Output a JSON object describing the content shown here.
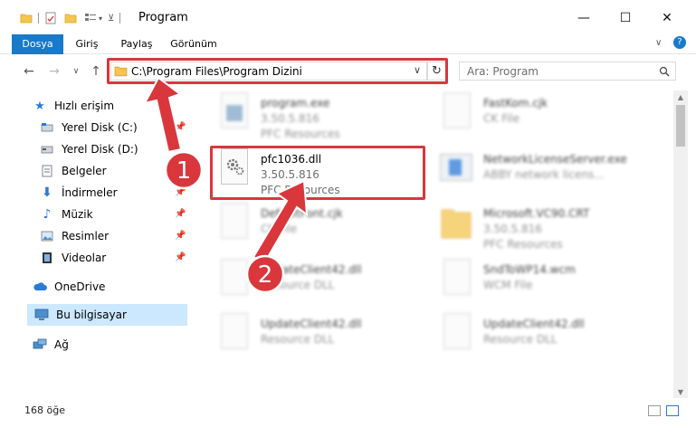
{
  "window": {
    "title": "Program",
    "minimize": "—",
    "maximize": "☐",
    "close": "✕"
  },
  "ribbon": {
    "tabs": [
      "Dosya",
      "Giriş",
      "Paylaş",
      "Görünüm"
    ],
    "help": "?"
  },
  "navigation": {
    "back": "←",
    "forward": "→",
    "recent": "∨",
    "up": "↑",
    "address": "C:\\Program Files\\Program Dizini",
    "address_dropdown": "∨",
    "refresh": "↻",
    "search_placeholder": "Ara: Program"
  },
  "sidebar": {
    "quick_access": "Hızlı erişim",
    "items": [
      {
        "label": "Yerel Disk (C:)",
        "icon": "drive-icon",
        "pinned": true
      },
      {
        "label": "Yerel Disk (D:)",
        "icon": "drive-icon",
        "pinned": false
      },
      {
        "label": "Belgeler",
        "icon": "documents-icon",
        "pinned": true
      },
      {
        "label": "İndirmeler",
        "icon": "download-icon",
        "pinned": true
      },
      {
        "label": "Müzik",
        "icon": "music-icon",
        "pinned": true
      },
      {
        "label": "Resimler",
        "icon": "pictures-icon",
        "pinned": true
      },
      {
        "label": "Videolar",
        "icon": "videos-icon",
        "pinned": true
      }
    ],
    "onedrive": "OneDrive",
    "this_pc": "Bu bilgisayar",
    "network": "Ağ",
    "pin_glyph": "📌"
  },
  "files": [
    {
      "name": "program.exe",
      "line2": "3.50.5.816",
      "line3": "PFC Resources",
      "blurred": true,
      "icon": "exe-icon"
    },
    {
      "name": "FastKom.cjk",
      "line2": "CK File",
      "line3": "",
      "blurred": true,
      "icon": "doc-icon"
    },
    {
      "name": "pfc1036.dll",
      "line2": "3.50.5.816",
      "line3": "PFC Resources",
      "blurred": false,
      "icon": "dll-gear-icon"
    },
    {
      "name": "NetworkLicenseServer.exe",
      "line2": "ABBY network licens...",
      "line3": "",
      "blurred": true,
      "icon": "exe-icon"
    },
    {
      "name": "DefaultFont.cjk",
      "line2": "CK File",
      "line3": "",
      "blurred": true,
      "icon": "doc-icon"
    },
    {
      "name": "Microsoft.VC90.CRT",
      "line2": "3.50.5.816",
      "line3": "PFC Resources",
      "blurred": true,
      "icon": "folder-icon"
    },
    {
      "name": "UpdateClient42.dll",
      "line2": "Resource DLL",
      "line3": "",
      "blurred": true,
      "icon": "dll-gear-icon"
    },
    {
      "name": "SndToWP14.wcm",
      "line2": "WCM File",
      "line3": "",
      "blurred": true,
      "icon": "doc-icon"
    },
    {
      "name": "UpdateClient42.dll",
      "line2": "Resource DLL",
      "line3": "",
      "blurred": true,
      "icon": "dll-gear-icon"
    },
    {
      "name": "UpdateClient42.dll",
      "line2": "Resource DLL",
      "line3": "",
      "blurred": true,
      "icon": "dll-gear-icon"
    }
  ],
  "status": {
    "count": "168 öğe"
  },
  "annotations": {
    "step1": "1",
    "step2": "2",
    "color": "#d9373c"
  },
  "colors": {
    "accent": "#1979ca",
    "selected": "#cce8ff",
    "folder": "#f4c64f"
  }
}
